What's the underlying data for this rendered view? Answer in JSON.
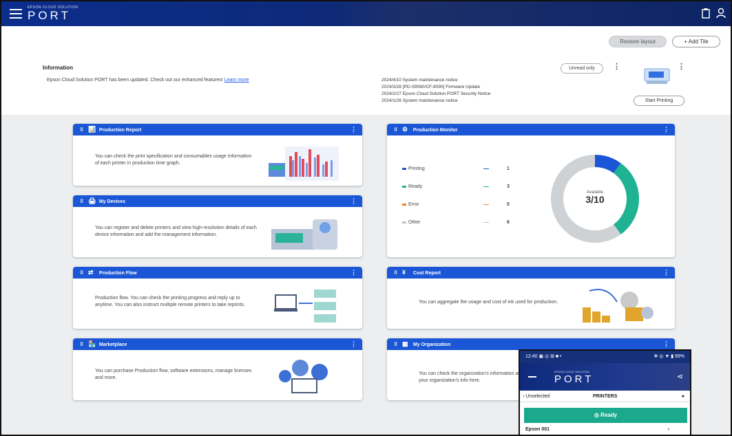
{
  "header": {
    "brand_small": "EPSON CLOUD SOLUTION",
    "brand": "PORT",
    "icons": [
      "clipboard-icon",
      "user-icon"
    ]
  },
  "info": {
    "btn_restore": "Restore layout",
    "btn_add_tile": "+ Add Tile",
    "title": "Information",
    "text": "Epson Cloud Solution PORT has been updated. Check out our enhanced features! ",
    "link": "Learn more",
    "news": [
      "2024/4/10  System maintenance notice",
      "2024/3/28  [PD-S9060/CF-8090] Firmware Update",
      "2024/2/27  Epson Cloud Solution PORT Security Notice",
      "2024/1/26  System maintenance notice"
    ],
    "refresh_label": "Unread only",
    "set_printer_label": "Start Printing"
  },
  "cards": {
    "production_report": {
      "title": "Production Report",
      "text": "You can check the print specification and consumables usage information of each printer in production time graph."
    },
    "my_devices": {
      "title": "My Devices",
      "text": "You can register and delete printers and view high-resolution details of each device information and add the management information."
    },
    "production_flow": {
      "title": "Production Flow",
      "text": "Production flow. You can check the printing progress and reply up to anytime. You can also instruct multiple remote printers to take reprints."
    },
    "marketplace": {
      "title": "Marketplace",
      "text": "You can purchase Production flow, software extensions, manage licenses and more."
    },
    "production_monitor": {
      "title": "Production Monitor"
    },
    "cost_report": {
      "title": "Cost Report",
      "text": "You can aggregate the usage and cost of ink used for production."
    },
    "my_organization": {
      "title": "My Organization",
      "text": "You can check the organization's information and manage your organization's info here."
    }
  },
  "monitor": {
    "center_label": "Available",
    "center_value": "3/10",
    "legend": [
      {
        "label": "Printing",
        "count": "1",
        "color": "#1a56d6"
      },
      {
        "label": "Ready",
        "count": "3",
        "color": "#1fb394"
      },
      {
        "label": "Error",
        "count": "0",
        "color": "#f07d2a"
      },
      {
        "label": "Other",
        "count": "6",
        "color": "#bfc3c7"
      }
    ]
  },
  "chart_data": {
    "type": "pie",
    "categories": [
      "Printing",
      "Ready",
      "Error",
      "Other"
    ],
    "values": [
      1,
      3,
      0,
      6
    ],
    "title": "",
    "colors": [
      "#1a56d6",
      "#1fb394",
      "#f07d2a",
      "#cfd2d5"
    ]
  },
  "phone": {
    "status_left": "12:40  ▣ ◎ ⊞ ■ •",
    "status_right": "✻ ◎ ▼ ▮ 99%",
    "brand_small": "EPSON CLOUD SOLUTION",
    "brand": "PORT",
    "back_label": "‹ Unselected",
    "sub_title": "PRINTERS",
    "ready_label": "Ready",
    "list_item": "Epson 001",
    "list_count": "›"
  }
}
